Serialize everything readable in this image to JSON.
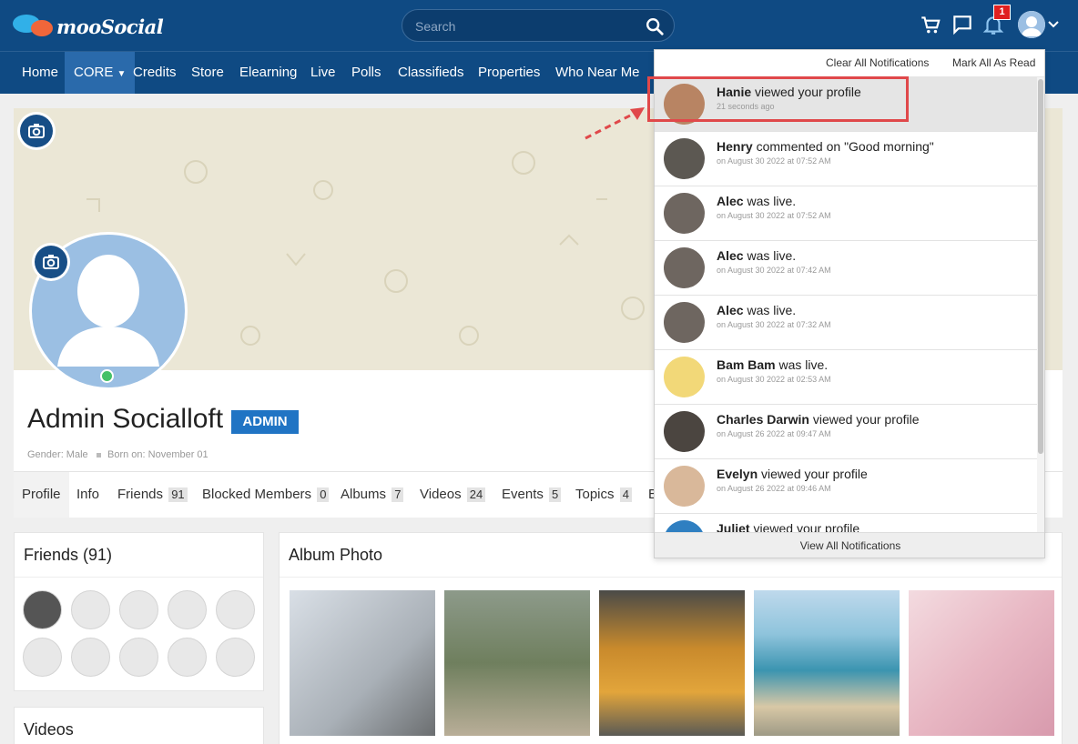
{
  "brand": {
    "name": "mooSocial"
  },
  "search": {
    "placeholder": "Search"
  },
  "header": {
    "notification_count": "1",
    "icons": [
      "cart-icon",
      "chat-icon",
      "bell-icon",
      "user-avatar-icon",
      "chevron-down-icon"
    ]
  },
  "nav": {
    "items": [
      "Home",
      "CORE",
      "Credits",
      "Store",
      "Elearning",
      "Live",
      "Polls",
      "Classifieds",
      "Properties",
      "Who Near Me"
    ]
  },
  "profile": {
    "name": "Admin Socialloft",
    "badge": "ADMIN",
    "gender": "Gender: Male",
    "born": "Born on: November 01"
  },
  "tabs": [
    {
      "label": "Profile",
      "count": ""
    },
    {
      "label": "Info",
      "count": ""
    },
    {
      "label": "Friends",
      "count": "91"
    },
    {
      "label": "Blocked Members",
      "count": "0"
    },
    {
      "label": "Albums",
      "count": "7"
    },
    {
      "label": "Videos",
      "count": "24"
    },
    {
      "label": "Events",
      "count": "5"
    },
    {
      "label": "Topics",
      "count": "4"
    },
    {
      "label": "B",
      "count": ""
    }
  ],
  "friends_panel": {
    "title": "Friends (91)"
  },
  "videos_panel": {
    "title": "Videos"
  },
  "album_panel": {
    "title": "Album Photo"
  },
  "notifications": {
    "clear_all": "Clear All Notifications",
    "mark_all": "Mark All As Read",
    "view_all": "View All Notifications",
    "items": [
      {
        "name": "Hanie",
        "action": "viewed your profile",
        "time": "21 seconds ago",
        "highlighted": true
      },
      {
        "name": "Henry",
        "action": "commented on \"Good morning\"",
        "time": "on August 30 2022 at 07:52 AM",
        "highlighted": false
      },
      {
        "name": "Alec",
        "action": "was live.",
        "time": "on August 30 2022 at 07:52 AM",
        "highlighted": false
      },
      {
        "name": "Alec",
        "action": "was live.",
        "time": "on August 30 2022 at 07:42 AM",
        "highlighted": false
      },
      {
        "name": "Alec",
        "action": "was live.",
        "time": "on August 30 2022 at 07:32 AM",
        "highlighted": false
      },
      {
        "name": "Bam Bam",
        "action": "was live.",
        "time": "on August 30 2022 at 02:53 AM",
        "highlighted": false
      },
      {
        "name": "Charles Darwin",
        "action": "viewed your profile",
        "time": "on August 26 2022 at 09:47 AM",
        "highlighted": false
      },
      {
        "name": "Evelyn",
        "action": "viewed your profile",
        "time": "on August 26 2022 at 09:46 AM",
        "highlighted": false
      },
      {
        "name": "Juliet",
        "action": "viewed your profile",
        "time": "",
        "highlighted": false
      }
    ]
  },
  "colors": {
    "header": "#0f4a83",
    "admin_badge": "#2074c4",
    "online": "#45c168",
    "annotation": "#e0484a"
  }
}
